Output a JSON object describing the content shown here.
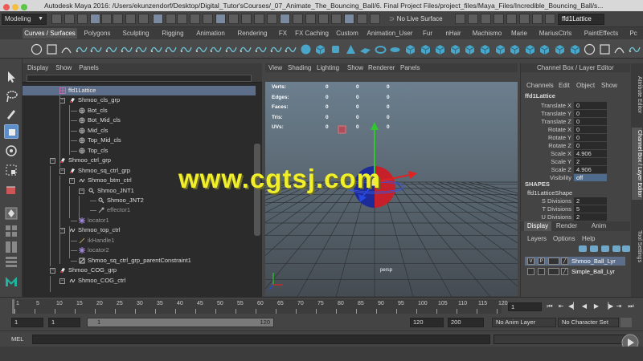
{
  "titlebar": {
    "title": "Autodesk Maya 2016: /Users/ekunzendorf/Desktop/Digital_Tutor'sCourses/_07_Animate_The_Bouncing_Ball/6. Final Project Files/project_files/Maya_Files/Incredible_Bouncing_Ball/s..."
  },
  "statusline": {
    "mode": "Modeling",
    "live_surface": "No Live Surface",
    "selected_node": "ffd1Lattice"
  },
  "shelf": {
    "tabs": [
      "Curves / Surfaces",
      "Polygons",
      "Sculpting",
      "Rigging",
      "Animation",
      "Rendering",
      "FX",
      "FX Caching",
      "Custom",
      "Animation_User",
      "Fur",
      "nHair",
      "Machismo",
      "Marie",
      "MariusCtrls",
      "PaintEffects",
      "Pc"
    ],
    "active_tab": 0
  },
  "outliner": {
    "menu": [
      "Display",
      "Show",
      "Panels"
    ],
    "rows": [
      {
        "label": "ffd1Lattice",
        "indent": 0,
        "selected": true,
        "icon": "lattice-icon",
        "dim": false
      },
      {
        "label": "Shmoo_cls_grp",
        "indent": 1,
        "icon": "transform-icon",
        "dim": false
      },
      {
        "label": "Bot_cls",
        "indent": 2,
        "icon": "cluster-icon",
        "dim": false
      },
      {
        "label": "Bot_Mid_cls",
        "indent": 2,
        "icon": "cluster-icon",
        "dim": false
      },
      {
        "label": "Mid_cls",
        "indent": 2,
        "icon": "cluster-icon",
        "dim": false
      },
      {
        "label": "Top_Mid_cls",
        "indent": 2,
        "icon": "cluster-icon",
        "dim": false
      },
      {
        "label": "Top_cls",
        "indent": 2,
        "icon": "cluster-icon",
        "dim": false
      },
      {
        "label": "Shmoo_ctrl_grp",
        "indent": 0,
        "icon": "transform-icon",
        "dim": false
      },
      {
        "label": "Shmoo_sq_ctrl_grp",
        "indent": 1,
        "icon": "transform-icon",
        "dim": false
      },
      {
        "label": "Shmoo_btm_ctrl",
        "indent": 2,
        "icon": "curve-icon",
        "dim": false
      },
      {
        "label": "Shmoo_JNT1",
        "indent": 3,
        "icon": "joint-icon",
        "dim": false
      },
      {
        "label": "Shmoo_JNT2",
        "indent": 4,
        "icon": "joint-icon",
        "dim": false
      },
      {
        "label": "effector1",
        "indent": 4,
        "icon": "effector-icon",
        "dim": true
      },
      {
        "label": "locator1",
        "indent": 2,
        "icon": "locator-icon",
        "dim": true
      },
      {
        "label": "Shmoo_top_ctrl",
        "indent": 1,
        "icon": "curve-icon",
        "dim": false
      },
      {
        "label": "ikHandle1",
        "indent": 2,
        "icon": "ikhandle-icon",
        "dim": true
      },
      {
        "label": "locator2",
        "indent": 2,
        "icon": "locator-icon",
        "dim": true
      },
      {
        "label": "Shmoo_sq_ctrl_grp_parentConstraint1",
        "indent": 2,
        "icon": "constraint-icon",
        "dim": false
      },
      {
        "label": "Shmoo_COG_grp",
        "indent": 0,
        "icon": "transform-icon",
        "dim": false
      },
      {
        "label": "Shmoo_COG_ctrl",
        "indent": 1,
        "icon": "curve-icon",
        "dim": false
      }
    ]
  },
  "viewport": {
    "menu": [
      "View",
      "Shading",
      "Lighting",
      "Show",
      "Renderer",
      "Panels"
    ],
    "hud": [
      {
        "label": "Verts:",
        "values": [
          "0",
          "0",
          "0"
        ]
      },
      {
        "label": "Edges:",
        "values": [
          "0",
          "0",
          "0"
        ]
      },
      {
        "label": "Faces:",
        "values": [
          "0",
          "0",
          "0"
        ]
      },
      {
        "label": "Tris:",
        "values": [
          "0",
          "0",
          "0"
        ]
      },
      {
        "label": "UVs:",
        "values": [
          "0",
          "0",
          "0"
        ]
      }
    ],
    "camera": "persp",
    "watermark": "www.cgtsj.com"
  },
  "channelbox": {
    "title": "Channel Box / Layer Editor",
    "menu": [
      "Channels",
      "Edit",
      "Object",
      "Show"
    ],
    "node": "ffd1Lattice",
    "attributes": [
      {
        "name": "Translate X",
        "value": "0"
      },
      {
        "name": "Translate Y",
        "value": "0"
      },
      {
        "name": "Translate Z",
        "value": "0"
      },
      {
        "name": "Rotate X",
        "value": "0"
      },
      {
        "name": "Rotate Y",
        "value": "0"
      },
      {
        "name": "Rotate Z",
        "value": "0"
      },
      {
        "name": "Scale X",
        "value": "4.906"
      },
      {
        "name": "Scale Y",
        "value": "2"
      },
      {
        "name": "Scale Z",
        "value": "4.906"
      },
      {
        "name": "Visibility",
        "value": "off"
      }
    ],
    "shapes_label": "SHAPES",
    "shape_node": "ffd1LatticeShape",
    "shape_attributes": [
      {
        "name": "S Divisions",
        "value": "2"
      },
      {
        "name": "T Divisions",
        "value": "5"
      },
      {
        "name": "U Divisions",
        "value": "2"
      }
    ]
  },
  "sidetabs": [
    "Attribute Editor",
    "Channel Box / Layer Editor",
    "Tool Settings"
  ],
  "layereditor": {
    "tabs": [
      "Display",
      "Render",
      "Anim"
    ],
    "menu": [
      "Layers",
      "Options",
      "Help"
    ],
    "layers": [
      {
        "v": "V",
        "p": "P",
        "name": "Shmoo_Ball_Lyr",
        "selected": true
      },
      {
        "v": "",
        "p": "",
        "name": "Simple_Ball_Lyr",
        "selected": false
      }
    ]
  },
  "timeslider": {
    "ticks": [
      "1",
      "5",
      "10",
      "15",
      "20",
      "25",
      "30",
      "35",
      "40",
      "45",
      "50",
      "55",
      "60",
      "65",
      "70",
      "75",
      "80",
      "85",
      "90",
      "95",
      "100",
      "105",
      "110",
      "115",
      "120"
    ],
    "current_frame": "1"
  },
  "rangeslider": {
    "start": "1",
    "anim_start": "1",
    "range_start": "1",
    "range_end": "120",
    "end": "120",
    "anim_end": "200",
    "anim_layer": "No Anim Layer",
    "character_set": "No Character Set"
  },
  "cmdline": {
    "label": "MEL"
  }
}
